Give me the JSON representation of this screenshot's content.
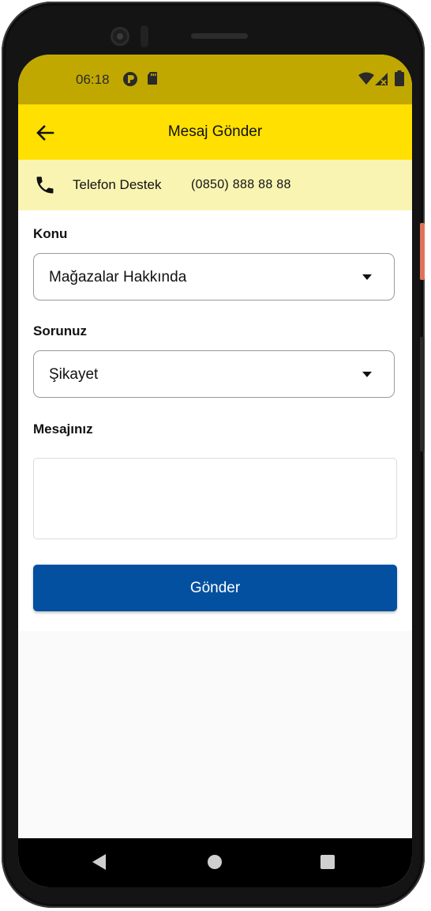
{
  "status_bar": {
    "time": "06:18",
    "icons": [
      "app-notification-icon",
      "sd-card-icon",
      "wifi-icon",
      "no-signal-icon",
      "battery-icon"
    ]
  },
  "app_bar": {
    "title": "Mesaj Gönder",
    "back_icon": "arrow-back-icon",
    "background": "#ffe000"
  },
  "support": {
    "label": "Telefon Destek",
    "number": "(0850) 888 88 88",
    "icon": "phone-icon",
    "background": "#faf4b3"
  },
  "form": {
    "topic": {
      "label": "Konu",
      "value": "Mağazalar Hakkında"
    },
    "issue": {
      "label": "Sorunuz",
      "value": "Şikayet"
    },
    "message": {
      "label": "Mesajınız",
      "value": ""
    },
    "submit_label": "Gönder"
  },
  "colors": {
    "status_bar": "#c1a800",
    "primary_button": "#0450a0"
  },
  "nav_bar": {
    "icons": [
      "nav-back-icon",
      "nav-home-icon",
      "nav-recents-icon"
    ]
  }
}
